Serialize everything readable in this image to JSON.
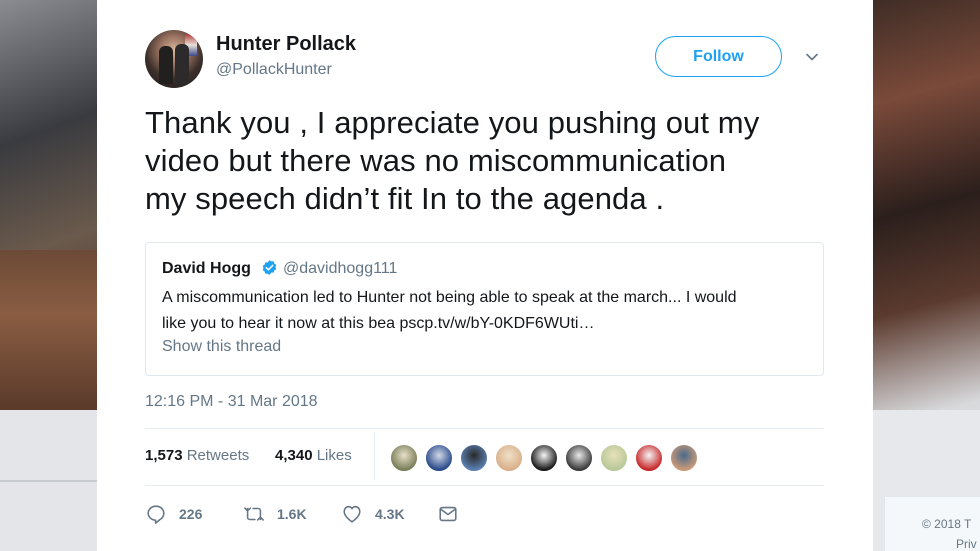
{
  "footer": {
    "copyright": "© 2018 T",
    "privacy": "Priv"
  },
  "tweet": {
    "author_name": "Hunter Pollack",
    "author_handle": "@PollackHunter",
    "follow_label": "Follow",
    "text_lines": [
      "Thank you , I appreciate you pushing out my",
      "video but there was no miscommunication",
      "my speech didn’t fit In to the agenda ."
    ],
    "timestamp": "12:16 PM - 31 Mar 2018",
    "retweets_count": "1,573",
    "retweets_label": "Retweets",
    "likes_count": "4,340",
    "likes_label": "Likes",
    "actions": {
      "reply_icon": "reply-icon",
      "reply_count": "226",
      "retweet_icon": "retweet-icon",
      "retweet_count": "1.6K",
      "like_icon": "heart-icon",
      "like_count": "4.3K",
      "dm_icon": "envelope-icon"
    },
    "likers": [
      {
        "color1": "#7a7f5a",
        "color2": "#e8e0c8"
      },
      {
        "color1": "#2a4a8a",
        "color2": "#d0d8e8"
      },
      {
        "color1": "#5a7fb0",
        "color2": "#2a2a2a"
      },
      {
        "color1": "#d9b08a",
        "color2": "#f0e0c8"
      },
      {
        "color1": "#1a1a1a",
        "color2": "#f4f4f4"
      },
      {
        "color1": "#3a3a3a",
        "color2": "#e8e8e8"
      },
      {
        "color1": "#b8c89a",
        "color2": "#e8e0b8"
      },
      {
        "color1": "#c8282a",
        "color2": "#f4f4f4"
      },
      {
        "color1": "#c89a7a",
        "color2": "#4a6a8a"
      }
    ]
  },
  "quoted": {
    "author_name": "David Hogg",
    "author_handle": "@davidhogg111",
    "verified": true,
    "text_lines": [
      "A miscommunication led to Hunter not being able to speak at the march... I would",
      "like you to hear it now at this bea pscp.tv/w/bY-0KDF6WUti…"
    ],
    "thread_link": "Show this thread"
  },
  "colors": {
    "accent": "#1da1f2",
    "text": "#14171a",
    "muted": "#657786",
    "border": "#e1e8ed"
  }
}
